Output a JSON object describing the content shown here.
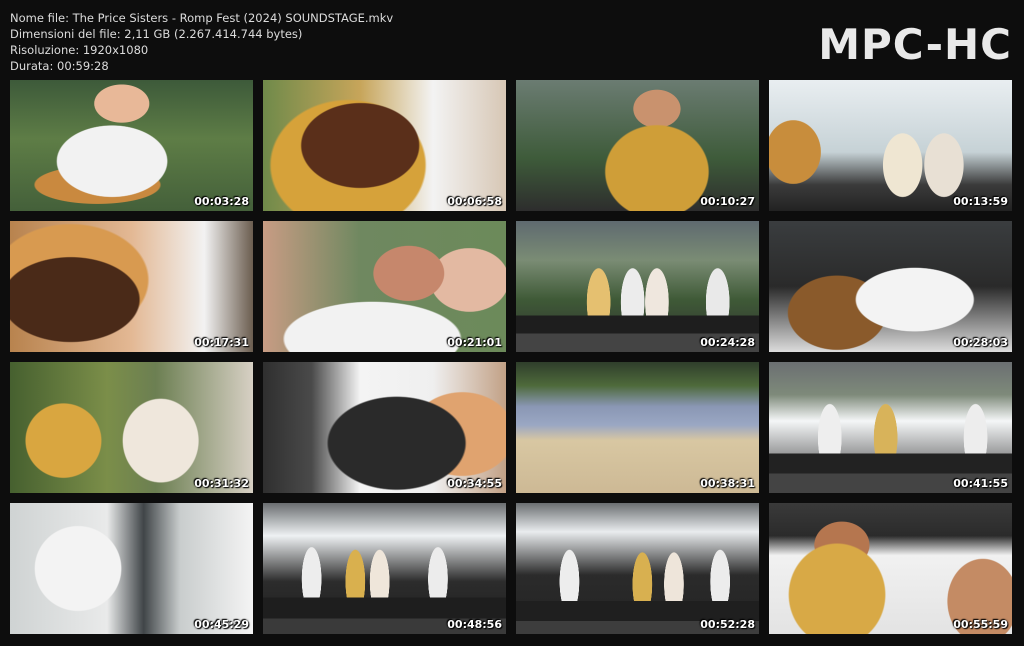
{
  "header": {
    "file_name": "Nome file: The Price Sisters - Romp Fest (2024) SOUNDSTAGE.mkv",
    "file_size": "Dimensioni del file: 2,11 GB (2.267.414.744 bytes)",
    "resolution": "Risoluzione: 1920x1080",
    "duration": "Durata: 00:59:28",
    "logo_text": "MPC-HC"
  },
  "thumbnails": [
    {
      "timestamp": "00:03:28"
    },
    {
      "timestamp": "00:06:58"
    },
    {
      "timestamp": "00:10:27"
    },
    {
      "timestamp": "00:13:59"
    },
    {
      "timestamp": "00:17:31"
    },
    {
      "timestamp": "00:21:01"
    },
    {
      "timestamp": "00:24:28"
    },
    {
      "timestamp": "00:28:03"
    },
    {
      "timestamp": "00:31:32"
    },
    {
      "timestamp": "00:34:55"
    },
    {
      "timestamp": "00:38:31"
    },
    {
      "timestamp": "00:41:55"
    },
    {
      "timestamp": "00:45:29"
    },
    {
      "timestamp": "00:48:56"
    },
    {
      "timestamp": "00:52:28"
    },
    {
      "timestamp": "00:55:59"
    }
  ]
}
